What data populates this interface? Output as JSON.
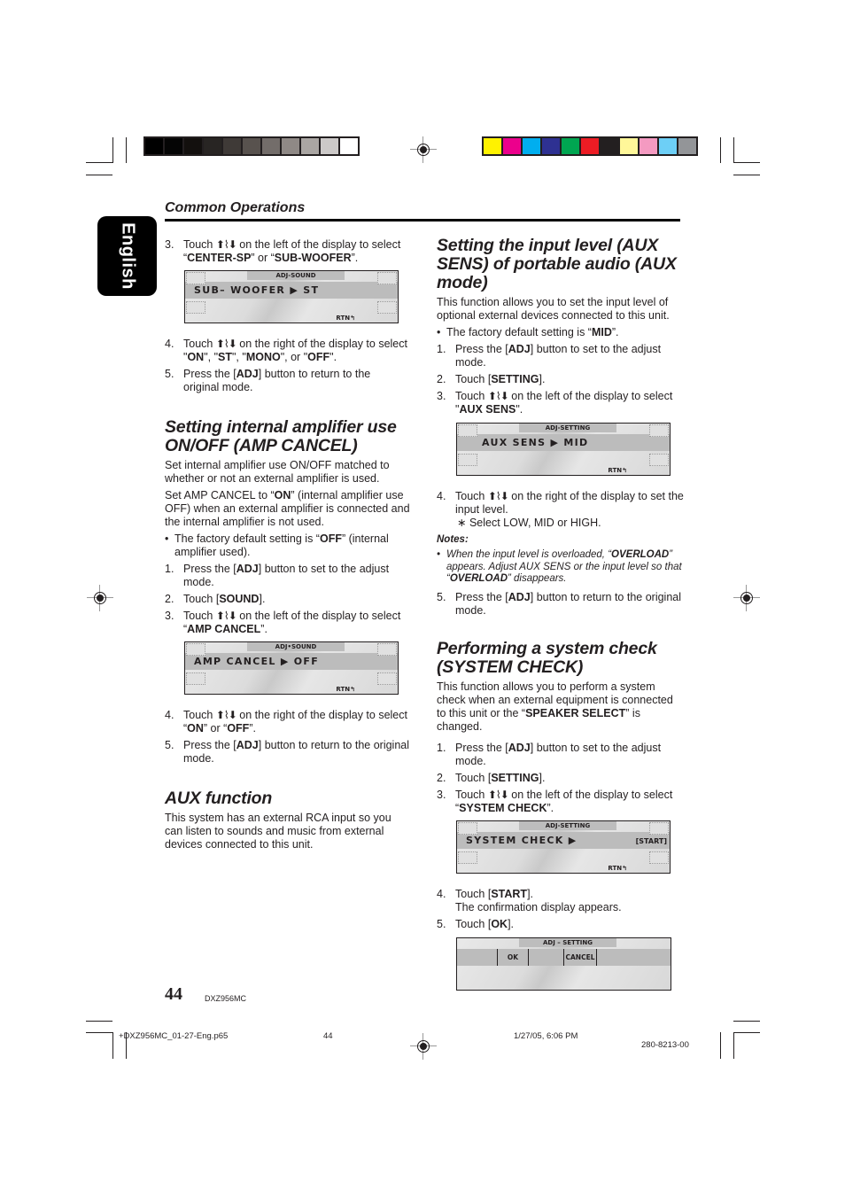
{
  "colors": {
    "grayscale_bar": [
      "#000000",
      "#050505",
      "#13100e",
      "#282523",
      "#3f3a37",
      "#58524e",
      "#736d6a",
      "#8f8986",
      "#aaa6a3",
      "#ccc9c8",
      "#ffffff"
    ],
    "color_bar": [
      "#fff200",
      "#ec008c",
      "#00aeef",
      "#2e3192",
      "#00a651",
      "#ed1c24",
      "#231f20",
      "#fff799",
      "#f49ac1",
      "#6dcff6",
      "#939598"
    ],
    "text": "#231f20",
    "tab_bg": "#000000"
  },
  "side_tab": {
    "label": "English"
  },
  "header": {
    "section": "Common Operations"
  },
  "icons": {
    "touch_arrows": "touch-up-scroll-down-icon"
  },
  "left": {
    "top_steps": [
      {
        "num": "3.",
        "pre": "Touch ",
        "post": " on the left of the display to select “",
        "b1": "CENTER-SP",
        "mid": "” or “",
        "b2": "SUB-WOOFER",
        "end": "”."
      }
    ],
    "lcd1": {
      "header": "ADJ-SOUND",
      "main": "SUB– WOOFER  ▶  ST",
      "rtn": "RTN↰"
    },
    "after_lcd1": {
      "step4": {
        "num": "4.",
        "pre": "Touch ",
        "post": " on the right of the display to select  \"",
        "b1": "ON",
        "s1": "\", \"",
        "b2": "ST",
        "s2": "\", \"",
        "b3": "MONO",
        "s3": "\", or \"",
        "b4": "OFF",
        "end": "\"."
      },
      "step5": {
        "num": "5.",
        "pre": "Press the [",
        "b": "ADJ",
        "post": "] button to return to the original mode."
      }
    },
    "amp": {
      "title": "Setting internal amplifier use ON/OFF (AMP CANCEL)",
      "p1": "Set internal amplifier use ON/OFF matched to whether or not an external amplifier is used.",
      "p2_pre": "Set AMP CANCEL to “",
      "p2_b": "ON",
      "p2_post": "” (internal amplifier use OFF) when an external amplifier is connected and the internal amplifier is not used.",
      "bullet_pre": "The factory default setting is “",
      "bullet_b": "OFF",
      "bullet_post": "” (internal amplifier used).",
      "s1_num": "1.",
      "s1_pre": "Press the [",
      "s1_b": "ADJ",
      "s1_post": "] button to set to the adjust mode.",
      "s2_num": "2.",
      "s2_pre": "Touch [",
      "s2_b": "SOUND",
      "s2_post": "].",
      "s3_num": "3.",
      "s3_pre": "Touch ",
      "s3_post": " on the left of the display to select “",
      "s3_b": "AMP CANCEL",
      "s3_end": "”.",
      "lcd": {
        "header": "ADJ•SOUND",
        "main": "AMP  CANCEL  ▶  OFF",
        "rtn": "RTN↰"
      },
      "s4_num": "4.",
      "s4_pre": "Touch ",
      "s4_post": " on the right of the display to select “",
      "s4_b1": "ON",
      "s4_mid": "” or “",
      "s4_b2": "OFF",
      "s4_end": "”.",
      "s5_num": "5.",
      "s5_pre": "Press the [",
      "s5_b": "ADJ",
      "s5_post": "] button to return to the original mode."
    },
    "aux": {
      "title": "AUX function",
      "p1": "This system has an external RCA input so you can listen to sounds and music from external devices connected to this unit."
    }
  },
  "right": {
    "auxsens": {
      "title": "Setting the input level (AUX SENS) of portable audio (AUX mode)",
      "p1": "This function allows you to set the input level of optional external devices connected to this unit.",
      "bullet_pre": "The factory default setting is “",
      "bullet_b": "MID",
      "bullet_post": "”.",
      "s1_num": "1.",
      "s1_pre": "Press the [",
      "s1_b": "ADJ",
      "s1_post": "] button to set to the adjust mode.",
      "s2_num": "2.",
      "s2_pre": "Touch [",
      "s2_b": "SETTING",
      "s2_post": "].",
      "s3_num": "3.",
      "s3_pre": "Touch ",
      "s3_post": " on the left of the display to select \"",
      "s3_b": "AUX SENS",
      "s3_end": "\".",
      "lcd": {
        "header": "ADJ-SETTING",
        "main": "AUX  SENS  ▶  MID",
        "rtn": "RTN↰"
      },
      "s4_num": "4.",
      "s4_pre": "Touch ",
      "s4_post": " on the right of the display to set the input level.",
      "s4_sub": "∗ Select LOW, MID or HIGH.",
      "notes_title": "Notes:",
      "note_pre": "When the input level is overloaded, “",
      "note_b1": "OVERLOAD",
      "note_mid": "” appears. Adjust AUX SENS or the input level so that “",
      "note_b2": "OVERLOAD",
      "note_end": "” disappears.",
      "s5_num": "5.",
      "s5_pre": "Press the [",
      "s5_b": "ADJ",
      "s5_post": "] button to return to the original mode."
    },
    "syscheck": {
      "title": "Performing a system check (SYSTEM CHECK)",
      "p1_pre": "This function allows you to perform a system check when an external equipment is connected to this unit or the “",
      "p1_b": "SPEAKER SELECT",
      "p1_post": "” is changed.",
      "s1_num": "1.",
      "s1_pre": "Press the [",
      "s1_b": "ADJ",
      "s1_post": "] button to set to the adjust mode.",
      "s2_num": "2.",
      "s2_pre": "Touch [",
      "s2_b": "SETTING",
      "s2_post": "].",
      "s3_num": "3.",
      "s3_pre": "Touch ",
      "s3_post": " on the left of the display to select “",
      "s3_b": "SYSTEM CHECK",
      "s3_end": "”.",
      "lcd": {
        "header": "ADJ-SETTING",
        "main": "SYSTEM  CHECK  ▶",
        "right": "[START]",
        "rtn": "RTN↰"
      },
      "s4_num": "4.",
      "s4_pre": "Touch [",
      "s4_b": "START",
      "s4_post": "].",
      "s4_sub": "The confirmation display appears.",
      "s5_num": "5.",
      "s5_pre": "Touch [",
      "s5_b": "OK",
      "s5_post": "].",
      "lcd2": {
        "header": "ADJ – SETTING",
        "ok": "OK",
        "cancel": "CANCEL"
      }
    }
  },
  "footer": {
    "page_number": "44",
    "model": "DXZ956MC",
    "file": "+DXZ956MC_01-27-Eng.p65",
    "file_page": "44",
    "timestamp": "1/27/05, 6:06 PM",
    "code": "280-8213-00"
  }
}
